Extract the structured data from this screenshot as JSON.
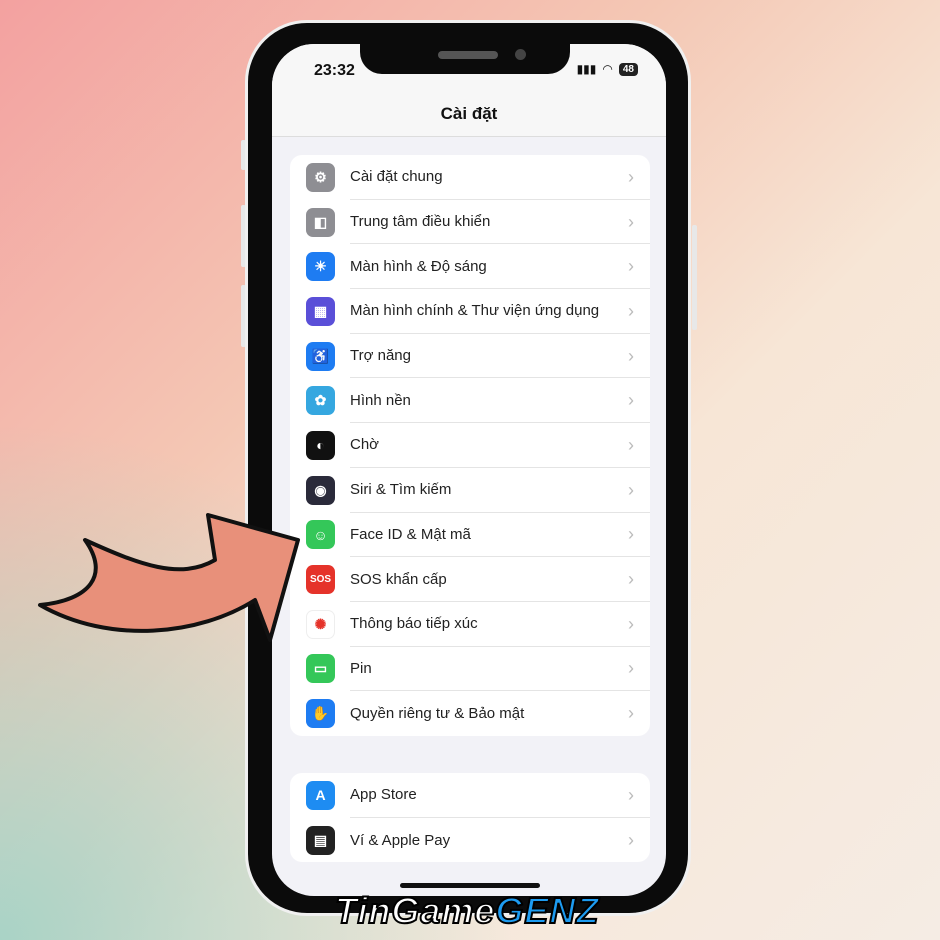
{
  "status_bar": {
    "time": "23:32",
    "battery": "48"
  },
  "header": {
    "title": "Cài đặt"
  },
  "groups": [
    {
      "items": [
        {
          "label": "Cài đặt chung",
          "icon": "gear-icon",
          "color": "#8e8e93",
          "glyph": "⚙"
        },
        {
          "label": "Trung tâm điều khiển",
          "icon": "control-center-icon",
          "color": "#8e8e93",
          "glyph": "◧"
        },
        {
          "label": "Màn hình & Độ sáng",
          "icon": "brightness-icon",
          "color": "#1e7cf2",
          "glyph": "☀"
        },
        {
          "label": "Màn hình chính & Thư viện ứng dụng",
          "icon": "home-screen-icon",
          "color": "#5a4fd8",
          "glyph": "▦"
        },
        {
          "label": "Trợ năng",
          "icon": "accessibility-icon",
          "color": "#1e7cf2",
          "glyph": "♿"
        },
        {
          "label": "Hình nền",
          "icon": "wallpaper-icon",
          "color": "#35a7e0",
          "glyph": "✿"
        },
        {
          "label": "Chờ",
          "icon": "standby-icon",
          "color": "#111111",
          "glyph": "◐"
        },
        {
          "label": "Siri & Tìm kiếm",
          "icon": "siri-icon",
          "color": "#2a2a3a",
          "glyph": "◉"
        },
        {
          "label": "Face ID & Mật mã",
          "icon": "face-id-icon",
          "color": "#34c759",
          "glyph": "☺"
        },
        {
          "label": "SOS khẩn cấp",
          "icon": "sos-icon",
          "color": "#e5332a",
          "glyph": "SOS"
        },
        {
          "label": "Thông báo tiếp xúc",
          "icon": "exposure-icon",
          "color": "#ffffff",
          "glyph": "✺"
        },
        {
          "label": "Pin",
          "icon": "battery-icon",
          "color": "#34c759",
          "glyph": "▭"
        },
        {
          "label": "Quyền riêng tư & Bảo mật",
          "icon": "privacy-hand-icon",
          "color": "#1e7cf2",
          "glyph": "✋"
        }
      ]
    },
    {
      "items": [
        {
          "label": "App Store",
          "icon": "app-store-icon",
          "color": "#1e8cf2",
          "glyph": "A"
        },
        {
          "label": "Ví & Apple Pay",
          "icon": "wallet-icon",
          "color": "#222222",
          "glyph": "▤"
        }
      ]
    }
  ],
  "watermark": {
    "text_a": "TinGame",
    "text_b": "GENZ"
  },
  "arrow_color": "#e8907a"
}
